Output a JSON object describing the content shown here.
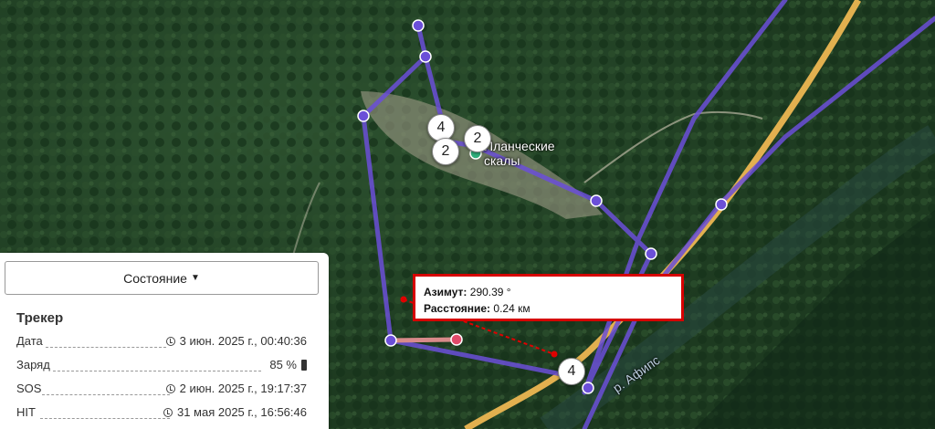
{
  "map": {
    "place_label": "Планческие скалы",
    "place_label_line1": "Планческие",
    "place_label_line2": "скалы",
    "river_label": "р. Афипс",
    "clusters": [
      "4",
      "2",
      "2",
      "4"
    ]
  },
  "measure": {
    "azimuth_label": "Азимут:",
    "azimuth_value": "290.39 °",
    "distance_label": "Расстояние:",
    "distance_value": "0.24 км"
  },
  "panel": {
    "state_button": "Состояние",
    "section_title": "Трекер",
    "rows": [
      {
        "label": "Дата",
        "value": "3 июн. 2025 г., 00:40:36",
        "icon": "clock-icon"
      },
      {
        "label": "Заряд",
        "value": "85 %",
        "icon": "battery-icon"
      },
      {
        "label": "SOS",
        "value": "2 июн. 2025 г., 19:17:37",
        "icon": "clock-icon"
      },
      {
        "label": "HIT",
        "value": "31 мая 2025 г., 16:56:46",
        "icon": "clock-icon"
      }
    ]
  },
  "colors": {
    "track": "#6b4fd8",
    "measure_line": "#e00000",
    "tooltip_border": "#d60000",
    "road": "#e2b04f"
  }
}
